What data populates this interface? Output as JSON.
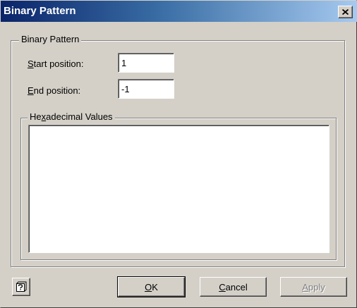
{
  "window": {
    "title": "Binary Pattern"
  },
  "group": {
    "legend": "Binary Pattern"
  },
  "fields": {
    "start_label_access": "S",
    "start_label_rest": "tart position:",
    "start_value": "1",
    "end_label_access": "E",
    "end_label_rest": "nd position:",
    "end_value": "-1"
  },
  "hex_group": {
    "legend_pre": "He",
    "legend_access": "x",
    "legend_post": "adecimal Values",
    "value": ""
  },
  "buttons": {
    "ok_access": "O",
    "ok_rest": "K",
    "cancel_access": "C",
    "cancel_rest": "ancel",
    "apply_access": "A",
    "apply_rest": "pply",
    "apply_enabled": false
  },
  "icons": {
    "close": "close-icon",
    "help": "context-help-icon"
  }
}
